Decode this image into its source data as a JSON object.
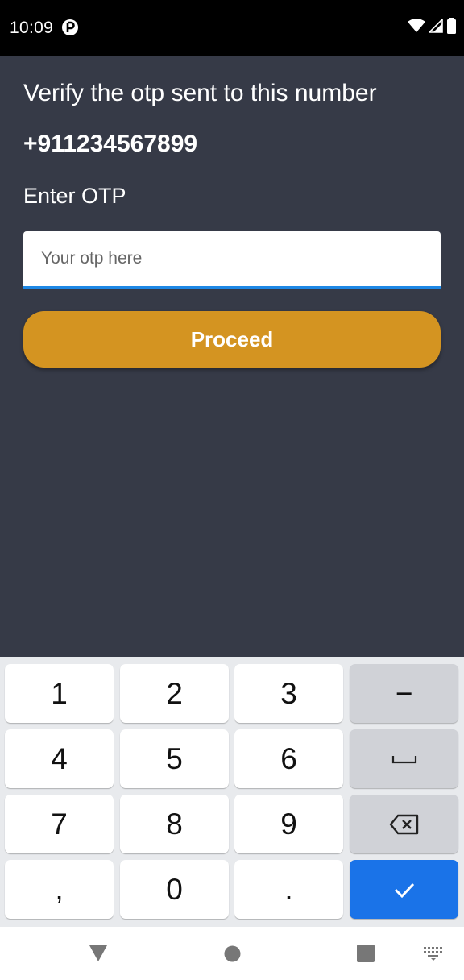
{
  "status_bar": {
    "time": "10:09",
    "icons": [
      "app-notification-icon",
      "wifi-icon",
      "cell-signal-icon",
      "battery-icon"
    ]
  },
  "screen": {
    "title": "Verify the otp sent to this number",
    "phone_number": "+911234567899",
    "otp_label": "Enter OTP",
    "otp_input": {
      "value": "",
      "placeholder": "Your otp here"
    },
    "proceed_label": "Proceed"
  },
  "keyboard": {
    "rows": [
      [
        "1",
        "2",
        "3",
        "−"
      ],
      [
        "4",
        "5",
        "6",
        "space"
      ],
      [
        "7",
        "8",
        "9",
        "backspace"
      ],
      [
        ",",
        "0",
        ".",
        "done"
      ]
    ],
    "labels": {
      "k1": "1",
      "k2": "2",
      "k3": "3",
      "minus": "−",
      "k4": "4",
      "k5": "5",
      "k6": "6",
      "k7": "7",
      "k8": "8",
      "k9": "9",
      "comma": ",",
      "k0": "0",
      "period": "."
    }
  },
  "nav_bar": {
    "icons": [
      "back-icon",
      "home-icon",
      "recents-icon",
      "keyboard-switch-icon"
    ]
  },
  "colors": {
    "background": "#363a47",
    "accent_button": "#d49421",
    "input_underline": "#1e88e5",
    "keyboard_enter": "#1a73e8"
  }
}
